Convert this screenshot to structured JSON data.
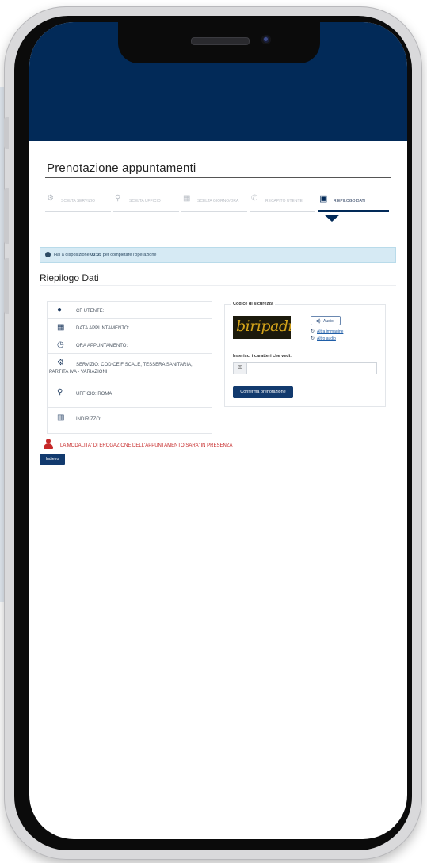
{
  "page": {
    "title": "Prenotazione appuntamenti"
  },
  "steps": [
    {
      "label": "SCELTA SERVIZIO",
      "icon": "gears-icon"
    },
    {
      "label": "SCELTA UFFICIO",
      "icon": "map-marker-icon"
    },
    {
      "label": "SCELTA GIORNO/ORA",
      "icon": "calendar-icon"
    },
    {
      "label": "RECAPITO UTENTE",
      "icon": "phone-icon"
    },
    {
      "label": "RIEPILOGO DATI",
      "icon": "id-card-icon"
    }
  ],
  "info": {
    "prefix": "Hai a disposizione ",
    "time": "03:35",
    "suffix": " per completare l'operazione"
  },
  "summary": {
    "title": "Riepilogo Dati",
    "rows": [
      {
        "label": "CF UTENTE:",
        "icon": "user-icon"
      },
      {
        "label": "DATA APPUNTAMENTO:",
        "icon": "calendar-icon"
      },
      {
        "label": "ORA APPUNTAMENTO:",
        "icon": "clock-icon"
      },
      {
        "label": "SERVIZIO: CODICE FISCALE, TESSERA SANITARIA,",
        "label2": "PARTITA IVA - VARIAZIONI",
        "icon": "gears-icon"
      },
      {
        "label": "UFFICIO: ROMA",
        "icon": "map-marker-icon"
      },
      {
        "label": "INDIRIZZO:",
        "icon": "map-icon"
      }
    ]
  },
  "captcha": {
    "title": "Codice di sicurezza",
    "image_text": "biripadi",
    "audio_label": "Audio",
    "other_image_label": "Altra immagine",
    "other_audio_label": "Altro audio",
    "input_label": "Inserisci i caratteri che vedi:",
    "input_value": "",
    "confirm_label": "Conferma prenotazione"
  },
  "notice": "LA MODALITA' DI EROGAZIONE DELL'APPUNTAMENTO SARA' IN PRESENZA",
  "back_label": "Indietro",
  "colors": {
    "header": "#022a58",
    "primary_button": "#123a6e",
    "info_bg": "#d6eaf4",
    "notice": "#c62828"
  }
}
